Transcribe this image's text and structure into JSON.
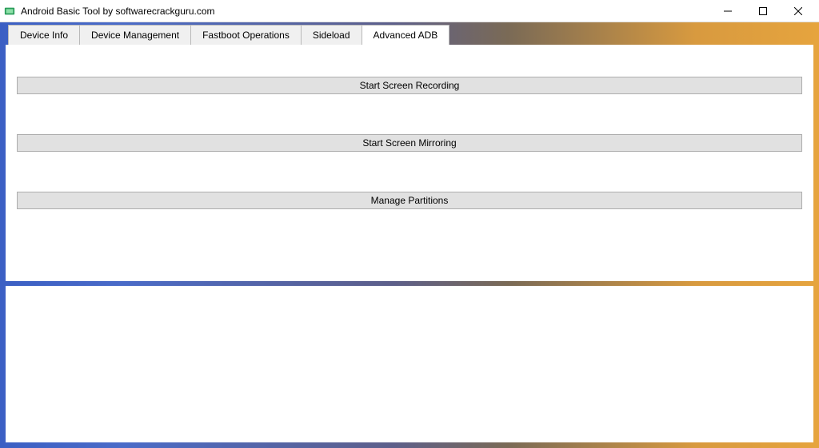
{
  "window": {
    "title": "Android Basic Tool by softwarecrackguru.com"
  },
  "tabs": [
    {
      "label": "Device Info"
    },
    {
      "label": "Device Management"
    },
    {
      "label": "Fastboot Operations"
    },
    {
      "label": "Sideload"
    },
    {
      "label": "Advanced ADB"
    }
  ],
  "buttons": {
    "record": "Start Screen Recording",
    "mirror": "Start Screen Mirroring",
    "partitions": "Manage Partitions"
  }
}
